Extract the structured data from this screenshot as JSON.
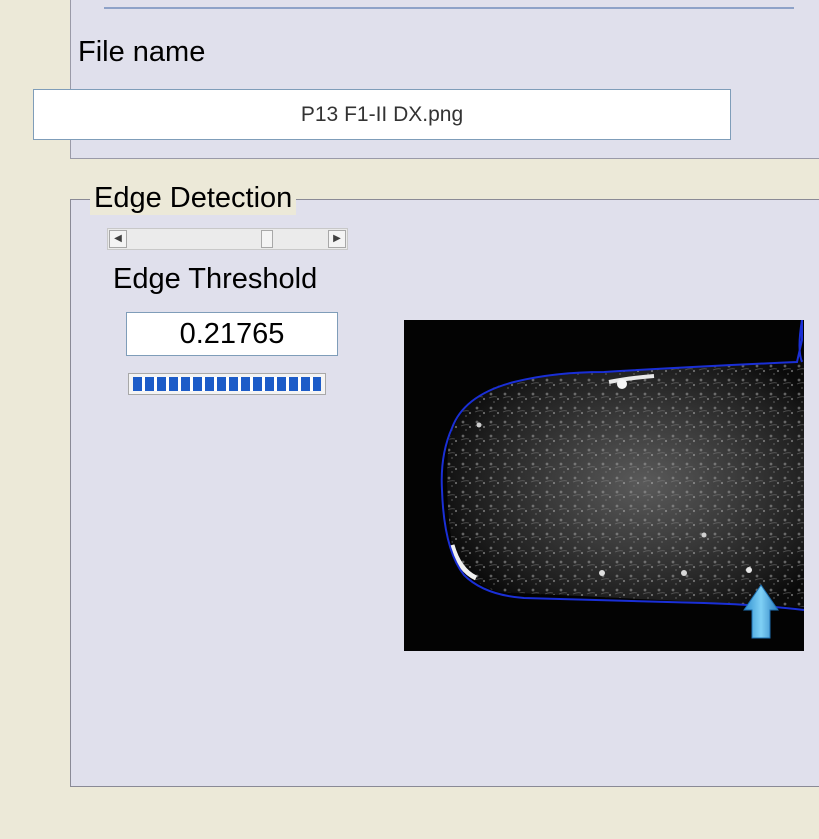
{
  "file_section": {
    "label": "File name",
    "file_name": "P13 F1-II DX.png"
  },
  "edge_detection": {
    "title": "Edge Detection",
    "slider": {
      "left_arrow_icon": "arrow-left-icon",
      "right_arrow_icon": "arrow-right-icon"
    },
    "threshold_label": "Edge Threshold",
    "threshold_value": "0.21765",
    "progress_fraction": 1.0
  },
  "image_view": {
    "contour_color": "#1a2fd6",
    "marker_icon": "arrow-up-icon",
    "marker_color": "#4fb3e8"
  },
  "colors": {
    "window_background": "#ece9d8",
    "panel_background": "#e0e0ec",
    "progress_color": "#1d5cc8"
  }
}
